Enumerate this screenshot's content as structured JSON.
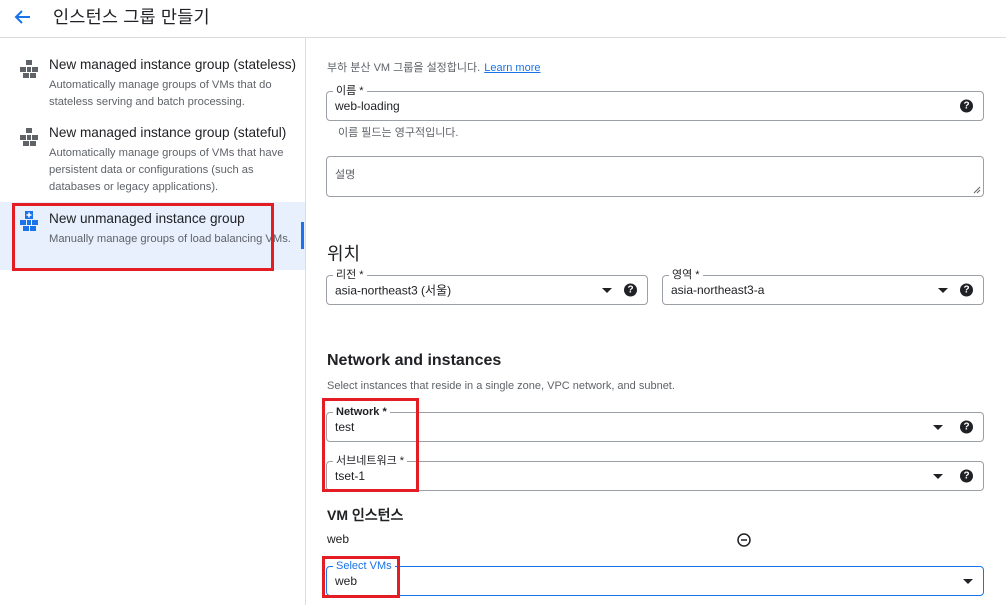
{
  "header": {
    "title": "인스턴스 그룹 만들기",
    "back_icon": "arrow-left-icon"
  },
  "options": [
    {
      "title": "New managed instance group (stateless)",
      "desc": "Automatically manage groups of VMs that do stateless serving and batch processing."
    },
    {
      "title": "New managed instance group (stateful)",
      "desc": "Automatically manage groups of VMs that have persistent data or configurations (such as databases or legacy applications)."
    },
    {
      "title": "New unmanaged instance group",
      "desc": "Manually manage groups of load balancing VMs."
    }
  ],
  "form": {
    "subtitle": "부하 분산 VM 그룹을 설정합니다.",
    "learn_more": "Learn more",
    "name_label": "이름 *",
    "name_value": "web-loading",
    "name_hint": "이름 필드는 영구적입니다.",
    "desc_label": "설명",
    "location_heading": "위치",
    "region_label": "리전 *",
    "region_value": "asia-northeast3 (서울)",
    "zone_label": "영역 *",
    "zone_value": "asia-northeast3-a",
    "network_heading": "Network and instances",
    "network_desc": "Select instances that reside in a single zone, VPC network, and subnet.",
    "network_label": "Network *",
    "network_value": "test",
    "subnet_label": "서브네트워크 *",
    "subnet_value": "tset-1",
    "vm_heading": "VM 인스턴스",
    "vm_item": "web",
    "select_vms_label": "Select VMs",
    "select_vms_value": "web",
    "help_glyph": "?"
  },
  "colors": {
    "accent": "#1a73e8",
    "highlight": "#e41c23",
    "selected_bg": "#e8f0fe"
  }
}
